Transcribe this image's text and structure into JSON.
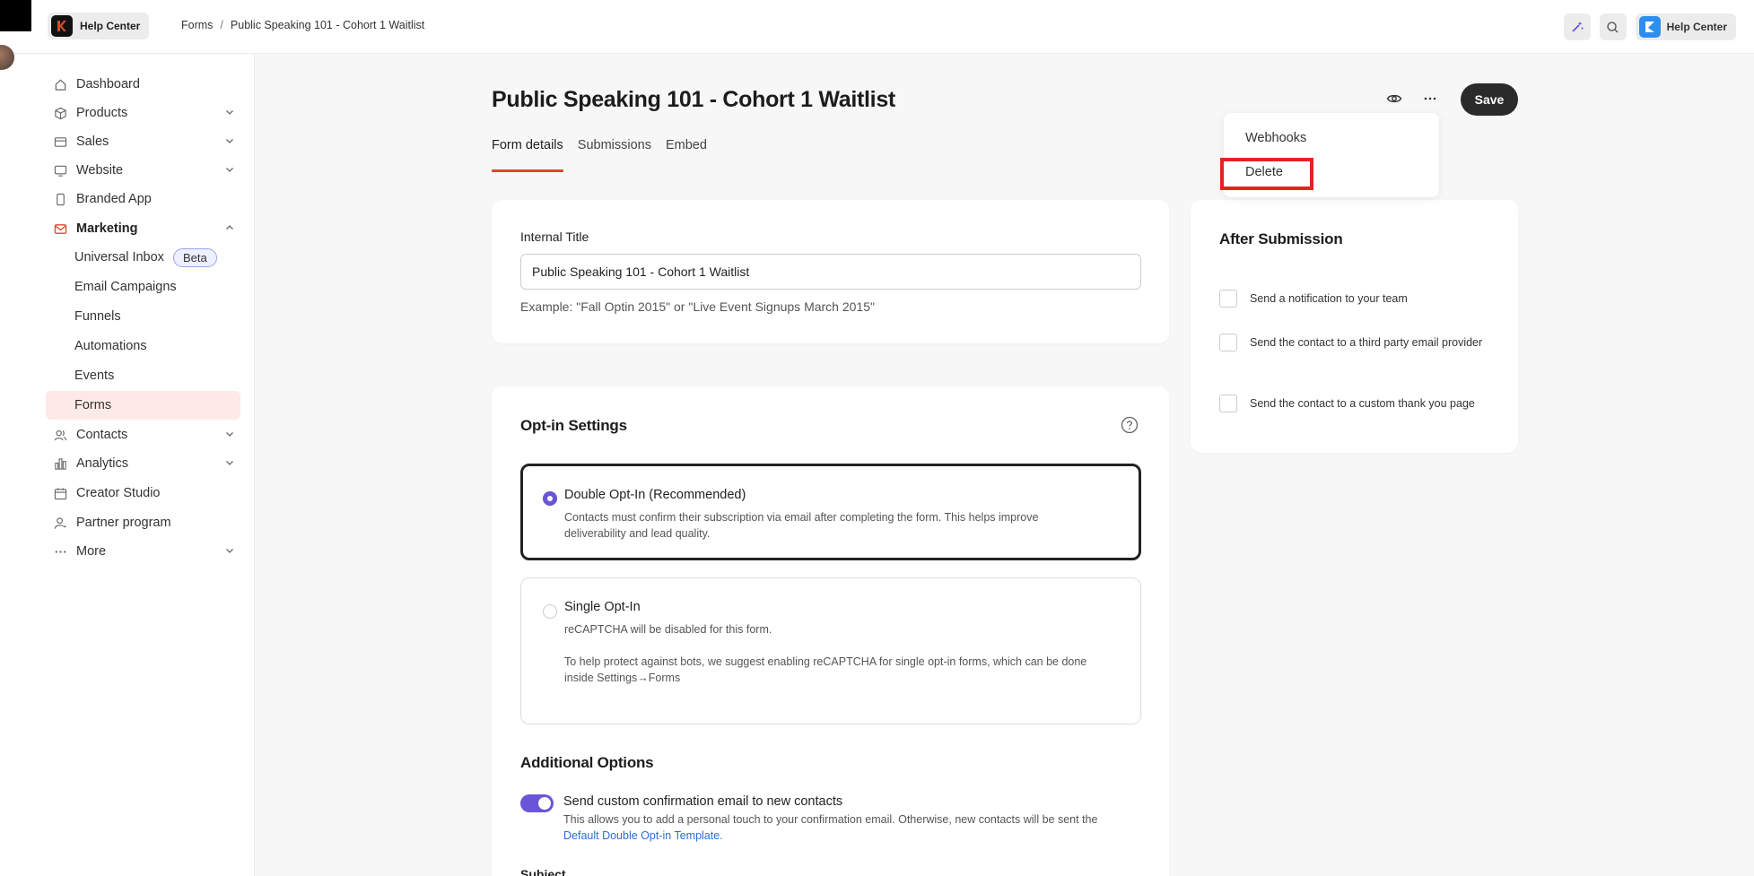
{
  "brand": {
    "label": "Help Center"
  },
  "breadcrumb": {
    "root": "Forms",
    "separator": "/",
    "current": "Public Speaking 101 - Cohort 1 Waitlist"
  },
  "topbar": {
    "help_label": "Help Center"
  },
  "sidebar": {
    "items": [
      {
        "label": "Dashboard",
        "icon": "home-icon"
      },
      {
        "label": "Products",
        "icon": "box-icon",
        "chevron": "down"
      },
      {
        "label": "Sales",
        "icon": "card-icon",
        "chevron": "down"
      },
      {
        "label": "Website",
        "icon": "monitor-icon",
        "chevron": "down"
      },
      {
        "label": "Branded App",
        "icon": "phone-icon"
      },
      {
        "label": "Marketing",
        "icon": "mail-icon",
        "chevron": "up",
        "expanded": true
      },
      {
        "label": "Universal Inbox",
        "badge": "Beta"
      },
      {
        "label": "Email Campaigns"
      },
      {
        "label": "Funnels"
      },
      {
        "label": "Automations"
      },
      {
        "label": "Events"
      },
      {
        "label": "Forms",
        "active": true
      },
      {
        "label": "Contacts",
        "icon": "users-icon",
        "chevron": "down"
      },
      {
        "label": "Analytics",
        "icon": "bar-chart-icon",
        "chevron": "down"
      },
      {
        "label": "Creator Studio",
        "icon": "calendar-icon"
      },
      {
        "label": "Partner program",
        "icon": "person-icon"
      },
      {
        "label": "More",
        "icon": "ellipsis-icon",
        "chevron": "down"
      }
    ]
  },
  "header": {
    "title": "Public Speaking 101 - Cohort 1 Waitlist",
    "tabs": [
      "Form details",
      "Submissions",
      "Embed"
    ],
    "active_tab": "Form details",
    "save_label": "Save"
  },
  "menu": {
    "items": [
      "Webhooks",
      "Delete"
    ],
    "highlighted": "Delete"
  },
  "internal_title": {
    "label": "Internal Title",
    "value": "Public Speaking 101 - Cohort 1 Waitlist",
    "hint": "Example: \"Fall Optin 2015\" or \"Live Event Signups March 2015\""
  },
  "optin": {
    "title": "Opt-in Settings",
    "double": {
      "title": "Double Opt-In (Recommended)",
      "desc": "Contacts must confirm their subscription via email after completing the form. This helps improve deliverability and lead quality.",
      "selected": true
    },
    "single": {
      "title": "Single Opt-In",
      "desc1": "reCAPTCHA will be disabled for this form.",
      "desc2": "To help protect against bots, we suggest enabling reCAPTCHA for single opt-in forms, which can be done inside Settings→Forms",
      "selected": false
    }
  },
  "additional": {
    "title": "Additional Options",
    "toggle_label": "Send custom confirmation email to new contacts",
    "toggle_on": true,
    "toggle_desc": "This allows you to add a personal touch to your confirmation email. Otherwise, new contacts will be sent the",
    "toggle_link": "Default Double Opt-in Template.",
    "subject_label": "Subject"
  },
  "after_submission": {
    "title": "After Submission",
    "options": [
      "Send a notification to your team",
      "Send the contact to a third party email provider",
      "Send the contact to a custom thank you page"
    ]
  },
  "colors": {
    "accent": "#e0452b",
    "primary": "#6a55d8",
    "highlight": "#e8231f",
    "link": "#2a6fd6"
  }
}
